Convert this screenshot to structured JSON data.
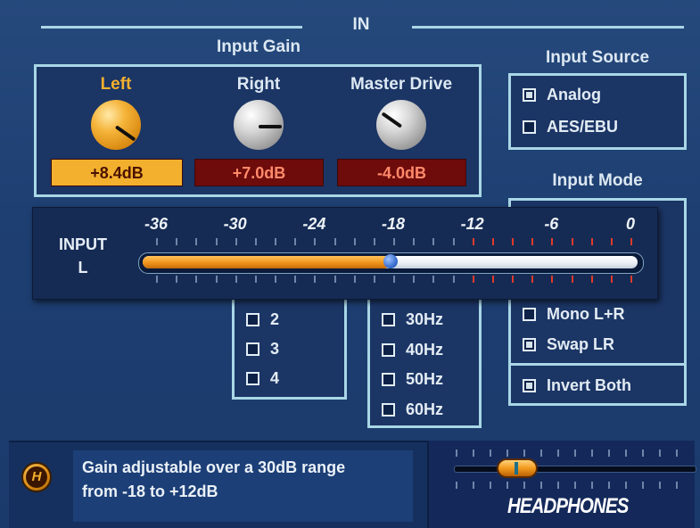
{
  "section_title": "IN",
  "input_gain": {
    "title": "Input Gain",
    "knobs": [
      {
        "label": "Left",
        "value": "+8.4dB",
        "active": true
      },
      {
        "label": "Right",
        "value": "+7.0dB",
        "active": false
      },
      {
        "label": "Master Drive",
        "value": "-4.0dB",
        "active": false
      }
    ]
  },
  "input_source": {
    "title": "Input Source",
    "options": [
      {
        "label": "Analog",
        "checked": true
      },
      {
        "label": "AES/EBU",
        "checked": false
      }
    ]
  },
  "input_mode": {
    "title": "Input Mode",
    "options": [
      {
        "label": "Mono L+R",
        "checked": false
      },
      {
        "label": "Swap LR",
        "checked": true
      }
    ],
    "invert": {
      "label": "Invert Both",
      "checked": true
    }
  },
  "number_list": {
    "options": [
      {
        "label": "2",
        "checked": false
      },
      {
        "label": "3",
        "checked": false
      },
      {
        "label": "4",
        "checked": false
      }
    ]
  },
  "hz_list": {
    "options": [
      {
        "label": "30Hz",
        "checked": false
      },
      {
        "label": "40Hz",
        "checked": false
      },
      {
        "label": "50Hz",
        "checked": false
      },
      {
        "label": "60Hz",
        "checked": false
      }
    ]
  },
  "meter": {
    "label_line1": "INPUT",
    "label_line2": "L",
    "scale": [
      "-36",
      "-30",
      "-24",
      "-18",
      "-12",
      "-6",
      "0"
    ],
    "level_db": -18,
    "min_db": -36,
    "max_db": 0
  },
  "help": {
    "badge": "H",
    "text_line1": "Gain adjustable over a 30dB range",
    "text_line2": "from -18 to +12dB"
  },
  "headphones": {
    "label": "HEADPHONES"
  },
  "colors": {
    "accent_orange": "#f3b02e",
    "value_red_bg": "#6e0c0c",
    "value_red_text": "#ff8a6a",
    "outline": "#a9d7e6"
  }
}
